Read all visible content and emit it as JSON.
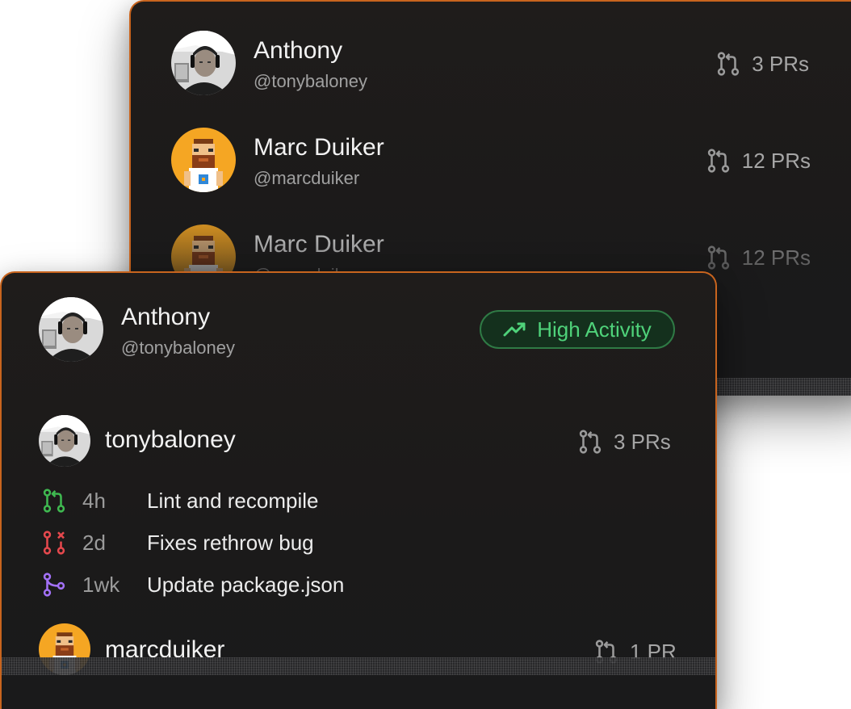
{
  "back_card": {
    "rows": [
      {
        "name": "Anthony",
        "handle": "@tonybaloney",
        "pr_count": "3 PRs",
        "avatar": "photo-avatar"
      },
      {
        "name": "Marc Duiker",
        "handle": "@marcduiker",
        "pr_count": "12 PRs",
        "avatar": "pixel-avatar"
      },
      {
        "name": "Marc Duiker",
        "handle": "@marcduiker",
        "pr_count": "12 PRs",
        "avatar": "pixel-avatar"
      }
    ]
  },
  "front_card": {
    "header": {
      "name": "Anthony",
      "handle": "@tonybaloney",
      "badge": {
        "label": "High Activity",
        "icon": "trending-up-icon",
        "color": "#4fd27a"
      }
    },
    "contributors": [
      {
        "username": "tonybaloney",
        "pr_count": "3 PRs",
        "activities": [
          {
            "status": "open",
            "icon": "pull-request-open-icon",
            "color": "#3fb950",
            "age": "4h",
            "title": "Lint and recompile"
          },
          {
            "status": "closed",
            "icon": "pull-request-closed-icon",
            "color": "#e5484d",
            "age": "2d",
            "title": "Fixes rethrow bug"
          },
          {
            "status": "merged",
            "icon": "pull-request-merged-icon",
            "color": "#a371f7",
            "age": "1wk",
            "title": "Update package.json"
          }
        ]
      },
      {
        "username": "marcduiker",
        "pr_count": "1 PR",
        "activities": []
      }
    ]
  },
  "colors": {
    "accent_border": "#c8641e",
    "card_bg": "#1c1b1b",
    "text_primary": "#f2f2f2",
    "text_secondary": "#a0a0a0"
  }
}
